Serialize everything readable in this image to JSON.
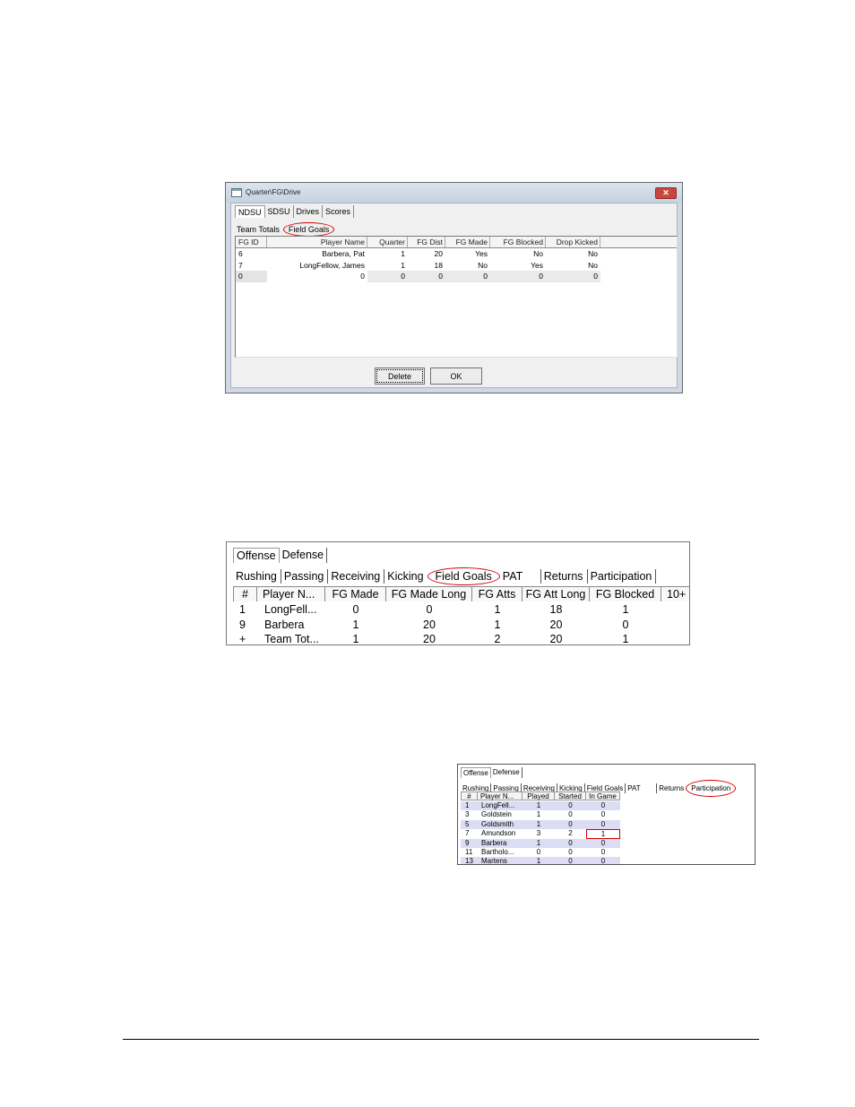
{
  "dialog": {
    "title": "Quarter\\FG\\Drive",
    "close_glyph": "✕",
    "tabs": [
      "NDSU",
      "SDSU",
      "Drives",
      "Scores"
    ],
    "subtabs": [
      "Team Totals",
      "Field Goals"
    ],
    "columns": [
      "FG ID",
      "Player Name",
      "Quarter",
      "FG Dist",
      "FG Made",
      "FG Blocked",
      "Drop Kicked"
    ],
    "rows": [
      [
        "6",
        "Barbera, Pat",
        "1",
        "20",
        "Yes",
        "No",
        "No"
      ],
      [
        "7",
        "LongFellow, James",
        "1",
        "18",
        "No",
        "Yes",
        "No"
      ],
      [
        "0",
        "0",
        "0",
        "0",
        "0",
        "0",
        "0"
      ]
    ],
    "buttons": {
      "delete": "Delete",
      "ok": "OK"
    }
  },
  "panel_fg": {
    "tabs": [
      "Offense",
      "Defense"
    ],
    "subtabs": [
      "Rushing",
      "Passing",
      "Receiving",
      "Kicking",
      "Field Goals",
      "PAT",
      "Returns",
      "Participation"
    ],
    "columns": [
      "#",
      "Player N...",
      "FG Made",
      "FG Made Long",
      "FG Atts",
      "FG Att Long",
      "FG Blocked",
      "10+"
    ],
    "rows": [
      [
        "1",
        "LongFell...",
        "0",
        "0",
        "1",
        "18",
        "1"
      ],
      [
        "9",
        "Barbera",
        "1",
        "20",
        "1",
        "20",
        "0"
      ],
      [
        "+",
        "Team Tot...",
        "1",
        "20",
        "2",
        "20",
        "1"
      ]
    ]
  },
  "panel_part": {
    "tabs": [
      "Offense",
      "Defense"
    ],
    "subtabs": [
      "Rushing",
      "Passing",
      "Receiving",
      "Kicking",
      "Field Goals",
      "PAT",
      "Returns",
      "Participation"
    ],
    "columns": [
      "#",
      "Player N...",
      "Played",
      "Started",
      "In Game"
    ],
    "rows": [
      [
        "1",
        "LongFell...",
        "1",
        "0",
        "0"
      ],
      [
        "3",
        "Goldstein",
        "1",
        "0",
        "0"
      ],
      [
        "5",
        "Goldsmith",
        "1",
        "0",
        "0"
      ],
      [
        "7",
        "Amundson",
        "3",
        "2",
        "1"
      ],
      [
        "9",
        "Barbera",
        "1",
        "0",
        "0"
      ],
      [
        "11",
        "Bartholo...",
        "0",
        "0",
        "0"
      ],
      [
        "13",
        "Martens",
        "1",
        "0",
        "0"
      ]
    ]
  }
}
